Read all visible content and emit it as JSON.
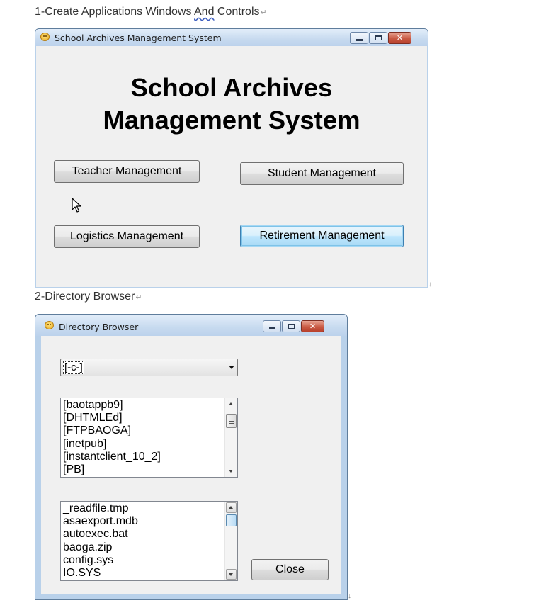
{
  "doc": {
    "section1_pre": "1-Create Applications Windows ",
    "section1_and": "And",
    "section1_post": " Controls",
    "section2": "2-Directory Browser",
    "para_mark": "↵",
    "break_mark": "↓"
  },
  "window1": {
    "title": "School Archives Management System",
    "heading_line1": "School Archives",
    "heading_line2": "Management System",
    "buttons": {
      "teacher": "Teacher Management",
      "student": "Student Management",
      "logistics": "Logistics Management",
      "retirement": "Retirement Management"
    },
    "focused_button": "retirement",
    "pointer_over": "teacher"
  },
  "window2": {
    "title": "Directory Browser",
    "drive_selected": "[-c-]",
    "directories": [
      "[baotappb9]",
      "[DHTMLEd]",
      "[FTPBAOGA]",
      "[inetpub]",
      "[instantclient_10_2]",
      "[PB]"
    ],
    "files": [
      "_readfile.tmp",
      "asaexport.mdb",
      "autoexec.bat",
      "baoga.zip",
      "config.sys",
      "IO.SYS"
    ],
    "close_label": "Close"
  },
  "colors": {
    "titlebar": "#c7daef",
    "client": "#f0f0f0",
    "close_button": "#c95b45",
    "focus_border": "#3c7fb1"
  }
}
